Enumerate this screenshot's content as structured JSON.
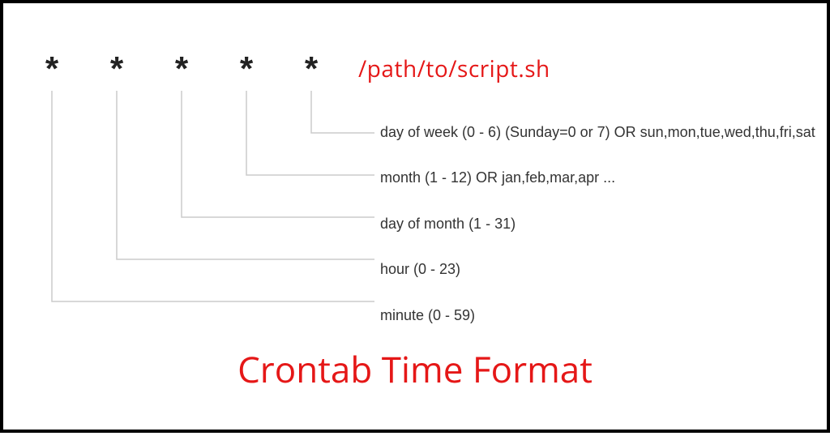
{
  "cron": {
    "stars": [
      "*",
      "*",
      "*",
      "*",
      "*"
    ],
    "script_path": "/path/to/script.sh",
    "labels": {
      "dow": "day of week (0 - 6) (Sunday=0 or 7) OR sun,mon,tue,wed,thu,fri,sat",
      "month": "month (1 - 12) OR jan,feb,mar,apr ...",
      "dom": "day of month (1 - 31)",
      "hour": "hour (0 - 23)",
      "minute": "minute (0 - 59)"
    }
  },
  "title": "Crontab Time Format"
}
